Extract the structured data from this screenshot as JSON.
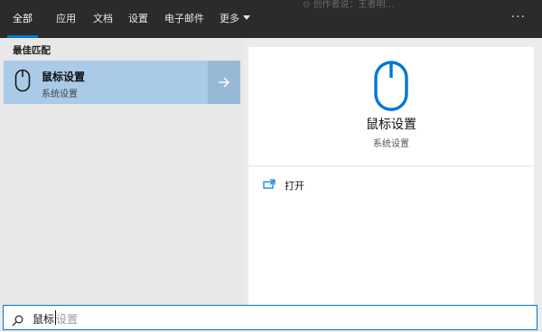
{
  "tabs": [
    {
      "label": "全部",
      "active": true
    },
    {
      "label": "应用"
    },
    {
      "label": "文档"
    },
    {
      "label": "设置"
    },
    {
      "label": "电子邮件"
    },
    {
      "label": "更多"
    }
  ],
  "more_options": "···",
  "top_partial_text": "⊙ 创作者说：王者明…",
  "left_pane": {
    "section_label": "最佳匹配",
    "result": {
      "title": "鼠标设置",
      "subtitle": "系统设置",
      "icon": "mouse-icon",
      "arrow_icon": "arrow-right-icon"
    }
  },
  "detail": {
    "title": "鼠标设置",
    "subtitle": "系统设置",
    "icon": "mouse-icon",
    "actions": [
      {
        "label": "打开",
        "icon": "open-window-icon"
      }
    ]
  },
  "search": {
    "typed": "鼠标",
    "suggestion": "设置",
    "icon": "search-icon"
  },
  "colors": {
    "accent": "#0078d4",
    "topbar": "#2b2b2b",
    "selected": "#a9cbe8"
  }
}
